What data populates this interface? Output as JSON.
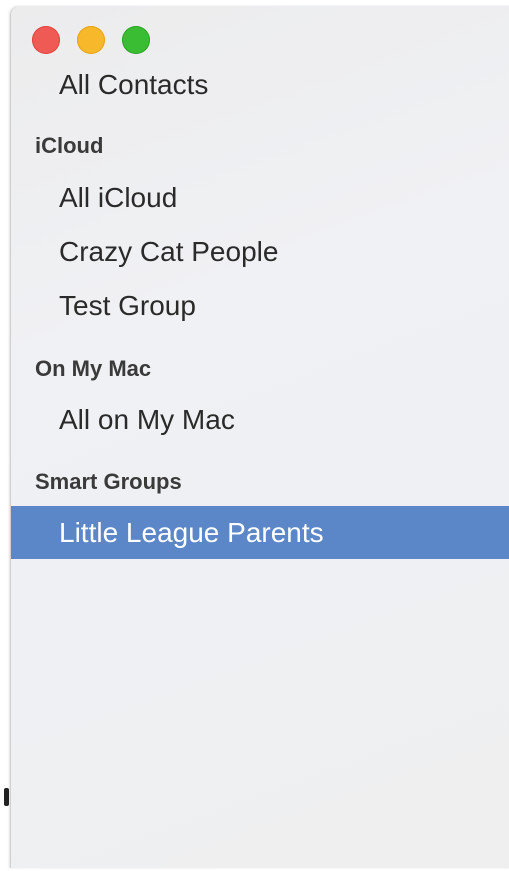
{
  "window": {
    "controls": {
      "close_color": "#f05a55",
      "minimize_color": "#f8b82b",
      "zoom_color": "#3bbd33"
    }
  },
  "sidebar": {
    "all_contacts": "All Contacts",
    "sections": [
      {
        "title": "iCloud",
        "items": [
          "All iCloud",
          "Crazy Cat People",
          "Test Group"
        ]
      },
      {
        "title": "On My Mac",
        "items": [
          "All on My Mac"
        ]
      },
      {
        "title": "Smart Groups",
        "items": [
          "Little League Parents"
        ]
      }
    ],
    "selected_item": "Little League Parents",
    "selection_color": "#5b87c9"
  }
}
